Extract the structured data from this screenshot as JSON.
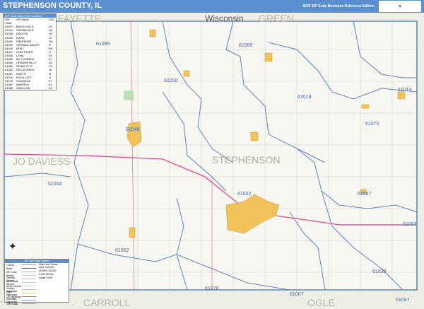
{
  "header": {
    "title": "STEPHENSON COUNTY, IL",
    "edition": "2026 ZIP Code Business Reference Edition",
    "logo": "Market MAPS"
  },
  "neighbors": {
    "north_west": "FAYETTE",
    "north": "Wisconsin",
    "north_east": "GREEN",
    "west": "JO DAVIESS",
    "south_west": "CARROLL",
    "south": "OGLE",
    "county": "STEPHENSON"
  },
  "zip_table": {
    "title": "ZIP Code Index/Grid Location",
    "columns": [
      "ZIP Code",
      "ZIP Name",
      "LOC"
    ],
    "rows": [
      [
        "61007",
        "BAILEYVILLE",
        "G7"
      ],
      [
        "61013",
        "CEDARVILLE",
        "D3"
      ],
      [
        "61018",
        "DAKOTA",
        "H3"
      ],
      [
        "61019",
        "DAVIS",
        "J2"
      ],
      [
        "61032",
        "FREEPORT",
        "G6"
      ],
      [
        "61039",
        "GERMAN VALLEY",
        "I7"
      ],
      [
        "61044",
        "KENT",
        "B5"
      ],
      [
        "61047",
        "LEAF RIVER",
        "I7"
      ],
      [
        "61048",
        "LENA",
        "D3"
      ],
      [
        "61050",
        "MC CONNELL",
        "E2"
      ],
      [
        "61060",
        "ORANGEVILLE",
        "G2"
      ],
      [
        "61062",
        "PEARL CITY",
        "C6"
      ],
      [
        "61063",
        "PECATONICA",
        "J6"
      ],
      [
        "61067",
        "RIDOTT",
        "I5"
      ],
      [
        "61070",
        "ROCK CITY",
        "I3"
      ],
      [
        "61078",
        "SHANNON",
        "E7"
      ],
      [
        "61087",
        "WARREN",
        "A1"
      ],
      [
        "61089",
        "WINSLOW",
        "D2"
      ]
    ]
  },
  "zip_labels": [
    {
      "zip": "61089"
    },
    {
      "zip": "61060"
    },
    {
      "zip": "61019"
    },
    {
      "zip": "61050"
    },
    {
      "zip": "61018"
    },
    {
      "zip": "61070"
    },
    {
      "zip": "61048"
    },
    {
      "zip": "61044"
    },
    {
      "zip": "61032"
    },
    {
      "zip": "61067"
    },
    {
      "zip": "61063"
    },
    {
      "zip": "61062"
    },
    {
      "zip": "61039"
    },
    {
      "zip": "61078"
    },
    {
      "zip": "61007"
    },
    {
      "zip": "61047"
    }
  ],
  "legend": {
    "title": "ZIP Code Map Legend",
    "items": [
      "County",
      "State",
      "ZIP Code",
      "Streets",
      "Primary Streets",
      "Secondary Streets",
      "Minor Streets",
      "County Highways",
      "State Highways",
      "US Highways",
      "Interstate Highways",
      "Toll Roads"
    ],
    "cities_title": "Cities and Towns",
    "cities": [
      "Over 100,000",
      "25,000-100,000",
      "5,000-25,000",
      "Under 5,000"
    ]
  },
  "colors": {
    "header": "#5b8fd0",
    "zip_boundary": "#5a86c0",
    "town": "#f2c25a",
    "highway": "#e0488f",
    "background": "#f7f6f0"
  }
}
